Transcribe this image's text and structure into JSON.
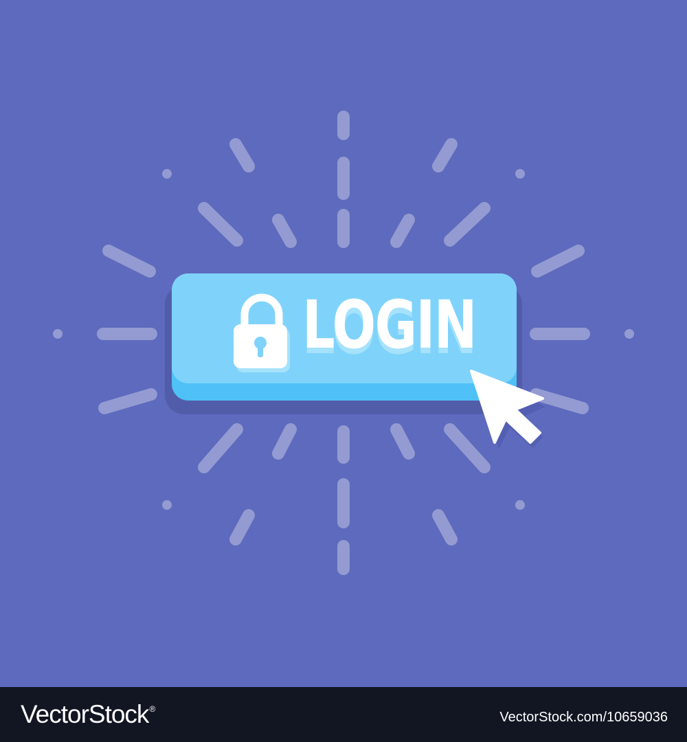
{
  "colors": {
    "background": "#5e6abd",
    "button_face": "#7fd3fb",
    "button_base": "#4fc1f7",
    "ray": "#ffffff",
    "footer": "#121622"
  },
  "button": {
    "label": "LOGIN",
    "icon": "padlock-icon"
  },
  "cursor": {
    "icon": "mouse-pointer-icon"
  },
  "footer": {
    "logo": "VectorStock",
    "registered_mark": "®",
    "credit": "VectorStock.com/10659036"
  }
}
